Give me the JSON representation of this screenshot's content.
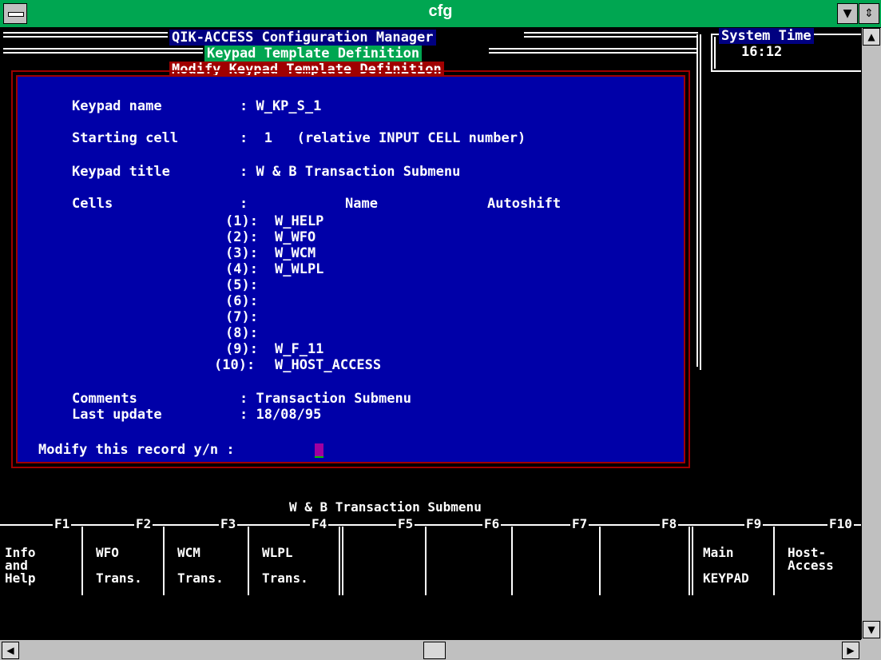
{
  "window": {
    "title": "cfg"
  },
  "header": {
    "app_title": "QIK-ACCESS Configuration Manager",
    "subtitle": "Keypad Template Definition",
    "dialog_title": "Modify Keypad Template Definition",
    "system_time_label": "System Time",
    "system_time": "16:12"
  },
  "form": {
    "keypad_name_label": "Keypad name",
    "keypad_name_value": ": W_KP_S_1",
    "starting_cell_label": "Starting cell",
    "starting_cell_value": ":  1   (relative INPUT CELL number)",
    "keypad_title_label": "Keypad title",
    "keypad_title_value": ": W & B Transaction Submenu",
    "cells_label": "Cells",
    "cells_colon": ":",
    "col_name": "Name",
    "col_autoshift": "Autoshift",
    "cells": [
      {
        "index": "(1):",
        "name": "W_HELP"
      },
      {
        "index": "(2):",
        "name": "W_WFO"
      },
      {
        "index": "(3):",
        "name": "W_WCM"
      },
      {
        "index": "(4):",
        "name": "W_WLPL"
      },
      {
        "index": "(5):",
        "name": ""
      },
      {
        "index": "(6):",
        "name": ""
      },
      {
        "index": "(7):",
        "name": ""
      },
      {
        "index": "(8):",
        "name": ""
      },
      {
        "index": "(9):",
        "name": "W_F_11"
      },
      {
        "index": "(10):",
        "name": "W_HOST_ACCESS"
      }
    ],
    "comments_label": "Comments",
    "comments_value": ": Transaction Submenu",
    "last_update_label": "Last update",
    "last_update_value": ": 18/08/95",
    "prompt": "Modify this record y/n :",
    "input_value": ""
  },
  "keypad": {
    "title": "W & B Transaction Submenu",
    "keys": [
      {
        "key": "F1",
        "lines": [
          "Info",
          "and",
          "Help"
        ]
      },
      {
        "key": "F2",
        "lines": [
          "WFO",
          "",
          "Trans."
        ]
      },
      {
        "key": "F3",
        "lines": [
          "WCM",
          "",
          "Trans."
        ]
      },
      {
        "key": "F4",
        "lines": [
          "WLPL",
          "",
          "Trans."
        ]
      },
      {
        "key": "F5",
        "lines": [
          "",
          "",
          ""
        ]
      },
      {
        "key": "F6",
        "lines": [
          "",
          "",
          ""
        ]
      },
      {
        "key": "F7",
        "lines": [
          "",
          "",
          ""
        ]
      },
      {
        "key": "F8",
        "lines": [
          "",
          "",
          ""
        ]
      },
      {
        "key": "F9",
        "lines": [
          "Main",
          "",
          "KEYPAD"
        ]
      },
      {
        "key": "F10",
        "lines": [
          "Host-",
          "Access",
          ""
        ]
      }
    ]
  },
  "colors": {
    "titlebar": "#00a651",
    "panel": "#0000a8",
    "border": "#a00000",
    "cursor": "#a000a0"
  }
}
